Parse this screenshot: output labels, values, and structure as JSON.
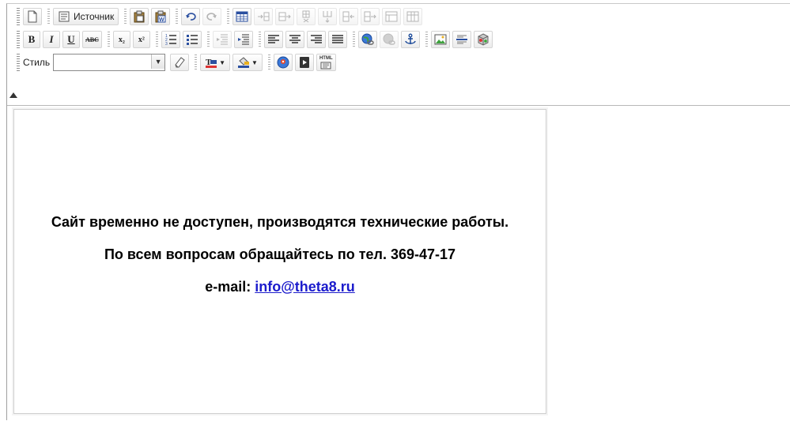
{
  "toolbar": {
    "source_label": "Источник",
    "style_label": "Стиль",
    "style_value": "",
    "bold_glyph": "B",
    "italic_glyph": "I",
    "underline_glyph": "U",
    "strike_glyph": "ABC",
    "subscript_glyph": "x₂",
    "superscript_glyph": "x²",
    "html_badge": "HTML"
  },
  "content": {
    "line1": "Сайт временно не доступен, производятся технические работы.",
    "line2": "По всем вопросам обращайтесь по тел. 369-47-17",
    "email_label": "e-mail: ",
    "email_link": "info@theta8.ru"
  },
  "colors": {
    "link": "#1b1bcc",
    "toolbar_border": "#b8b8b8"
  }
}
